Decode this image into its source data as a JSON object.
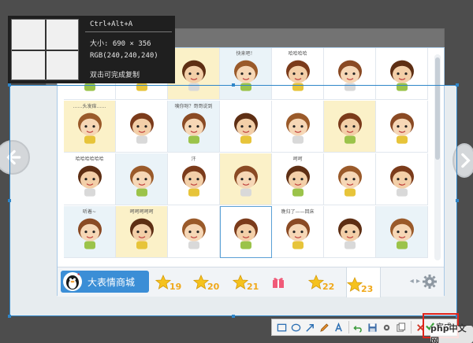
{
  "info": {
    "shortcut": "Ctrl+Alt+A",
    "size": "大小: 690 × 356",
    "rgb": "RGB(240,240,240)",
    "hint": "双击可完成复制"
  },
  "emoji_captions": [
    "",
    "",
    "",
    "快来吧！",
    "哈哈哈哈",
    "",
    "",
    "……头发痒……",
    "",
    "咦你呀？哥哥说到",
    "",
    "",
    "",
    "",
    "哈哈哈哈哈哈",
    "",
    "汗",
    "",
    "呵呵",
    "",
    "",
    "听着~",
    "呵呵呵呵呵",
    "",
    "",
    "晚归了——回床",
    "",
    "",
    "",
    ""
  ],
  "tabbar": {
    "store_label": "大表情商城",
    "tabs": [
      "19",
      "20",
      "21",
      "",
      "22",
      "23"
    ],
    "nav": "◂ ▸"
  },
  "toolbar": {
    "done_label": "完成"
  },
  "watermark": "php中文网",
  "colors": {
    "selection": "#2f86c9",
    "store": "#3b8ed6",
    "done_border": "#e0241b",
    "star": "#f0a81a"
  }
}
